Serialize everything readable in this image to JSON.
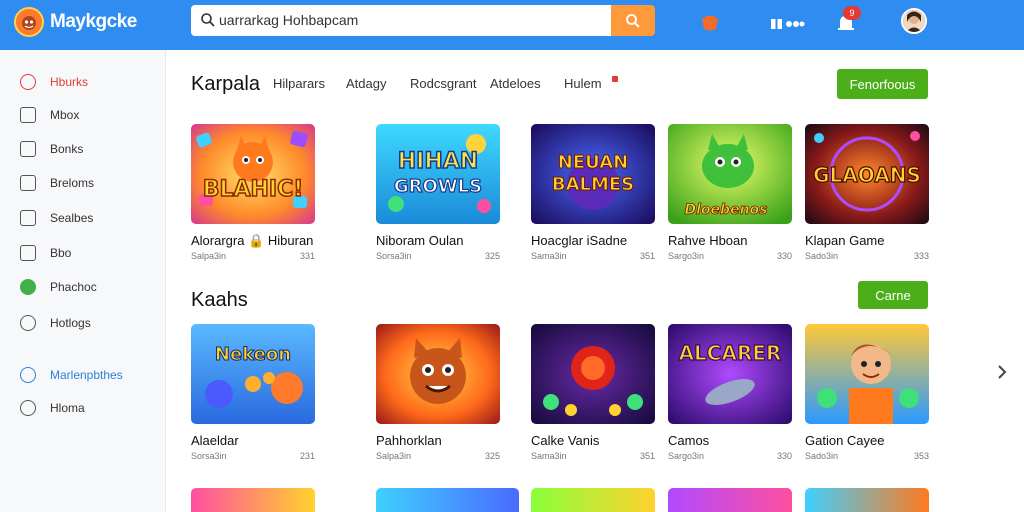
{
  "app": {
    "brand": "Maykgcke"
  },
  "search": {
    "value": "uarrarkag Hohbapcam"
  },
  "header": {
    "notif_count": "9"
  },
  "sidebar": {
    "items": [
      {
        "label": "Hburks"
      },
      {
        "label": "Mbox"
      },
      {
        "label": "Bonks"
      },
      {
        "label": "Breloms"
      },
      {
        "label": "Sealbes"
      },
      {
        "label": "Bbo"
      },
      {
        "label": "Phachoc"
      },
      {
        "label": "Hotlogs"
      },
      {
        "label": "Marlenpbthes"
      },
      {
        "label": "Hloma"
      }
    ]
  },
  "section1": {
    "title": "Karpala",
    "tabs": [
      "Hilparars",
      "Atdagy",
      "Rodcsgrant",
      "Atdeloes",
      "Hulem"
    ],
    "button": "Fenorfoous",
    "cards": [
      {
        "title": "Alorargra 🔒 Hiburan",
        "meta_left": "Salpa3in",
        "meta_right": "331"
      },
      {
        "title": "Niboram Oulan",
        "meta_left": "Sorsa3in",
        "meta_right": "325"
      },
      {
        "title": "Hoacglar iSadne",
        "meta_left": "Sama3in",
        "meta_right": "351"
      },
      {
        "title": "Rahve Hboan",
        "meta_left": "Sargo3in",
        "meta_right": "330"
      },
      {
        "title": "Klapan Game",
        "meta_left": "Sado3in",
        "meta_right": "333"
      }
    ]
  },
  "section2": {
    "title": "Kaahs",
    "button": "Carne",
    "cards": [
      {
        "title": "Alaeldar",
        "meta_left": "Sorsa3in",
        "meta_right": "231"
      },
      {
        "title": "Pahhorklan",
        "meta_left": "Salpa3in",
        "meta_right": "325"
      },
      {
        "title": "Calke Vanis",
        "meta_left": "Sama3in",
        "meta_right": "351"
      },
      {
        "title": "Camos",
        "meta_left": "Sargo3in",
        "meta_right": "330"
      },
      {
        "title": "Gation Cayee",
        "meta_left": "Sado3in",
        "meta_right": "353"
      }
    ]
  },
  "thumbs_text": {
    "t1": "BLAHIC!",
    "t2a": "HIHAN",
    "t2b": "GROWLS",
    "t3a": "NEUAN",
    "t3b": "BALMES",
    "t4": "Dloebenos",
    "t5": "GLAOANS",
    "t6": "Nekeon",
    "t8": "",
    "t9": "ALCARER"
  },
  "colors": {
    "topbar": "#2f8cf0",
    "accent_green": "#4caf1a",
    "search_btn": "#ff9a3c"
  }
}
